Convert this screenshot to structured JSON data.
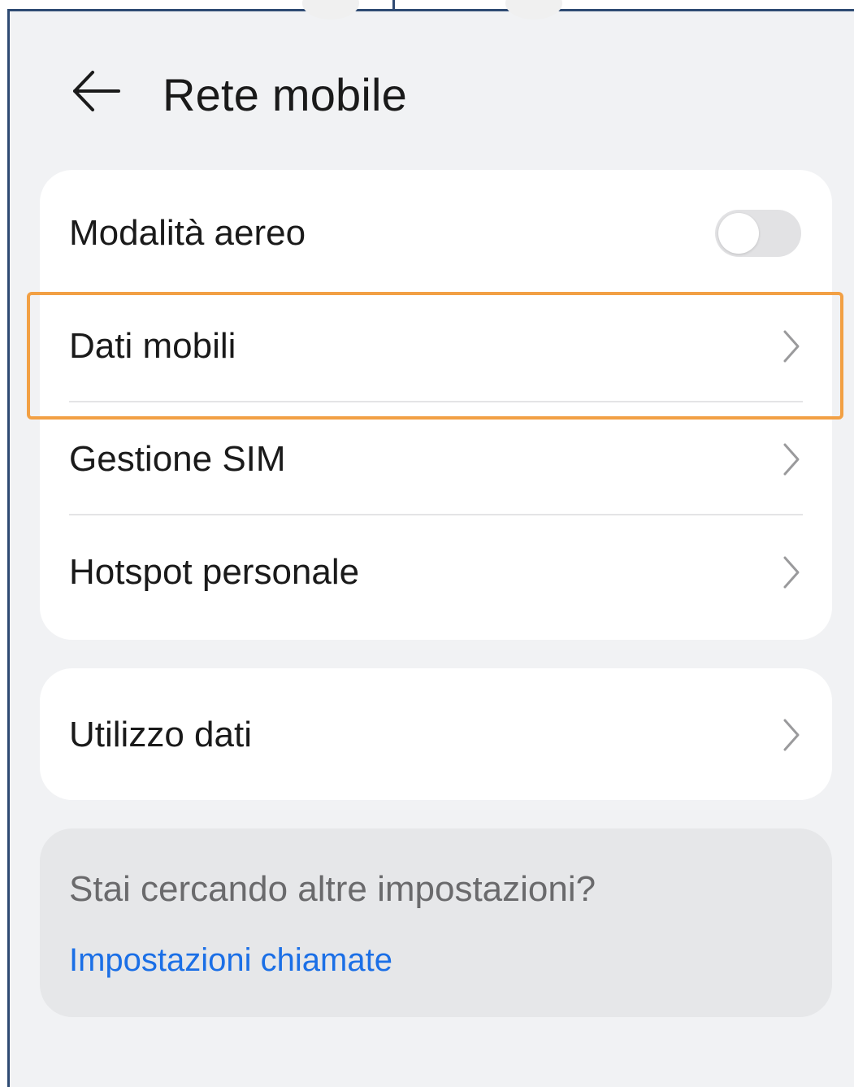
{
  "header": {
    "title": "Rete mobile",
    "back_icon": "arrow-left-icon"
  },
  "main_card": {
    "items": [
      {
        "label": "Modalità aereo",
        "control": "toggle",
        "toggle_on": false
      },
      {
        "label": "Dati mobili",
        "control": "chevron",
        "highlighted": true
      },
      {
        "label": "Gestione SIM",
        "control": "chevron"
      },
      {
        "label": "Hotspot personale",
        "control": "chevron"
      }
    ]
  },
  "usage_card": {
    "label": "Utilizzo dati"
  },
  "more_card": {
    "question": "Stai cercando altre impostazioni?",
    "link": "Impostazioni chiamate"
  },
  "colors": {
    "background": "#f1f2f4",
    "card": "#ffffff",
    "link": "#1b6fe6",
    "highlight": "#f2a044",
    "frame_border": "#2e4a73"
  }
}
